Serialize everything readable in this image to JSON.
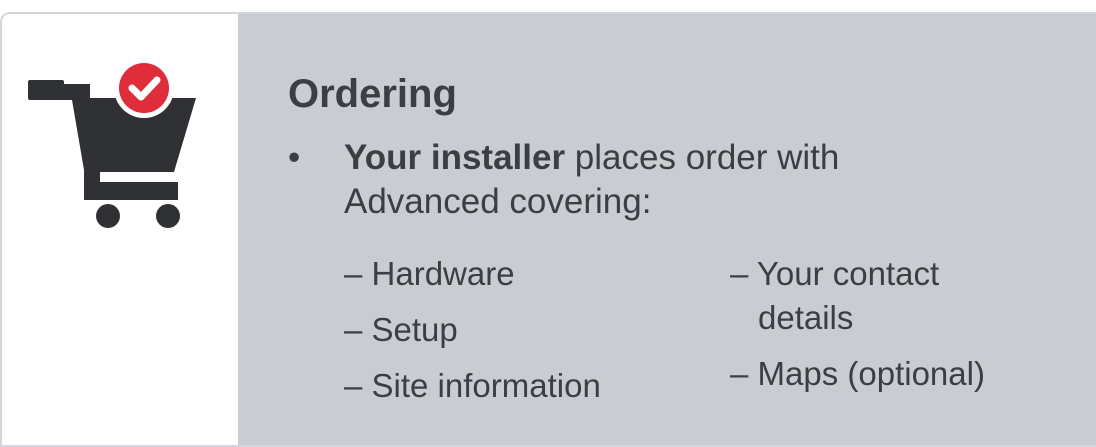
{
  "slide": {
    "title": "Ordering",
    "bullet_symbol": "•",
    "bullet_bold": "Your installer",
    "bullet_rest_line1": " places order with",
    "bullet_line2": "Advanced covering:",
    "left_items": [
      "– Hardware",
      "– Setup",
      "– Site information"
    ],
    "right_items": {
      "contact_line1": "– Your contact",
      "contact_line2": "details",
      "maps": "– Maps (optional)"
    }
  },
  "icon": {
    "name": "shopping-cart-with-checkmark",
    "cart_color": "#2f3134",
    "badge_color": "#e02d3c",
    "check_color": "#ffffff"
  },
  "colors": {
    "panel_background": "#c9cdd2",
    "text": "#3b3e42",
    "border": "#d3d6da"
  }
}
